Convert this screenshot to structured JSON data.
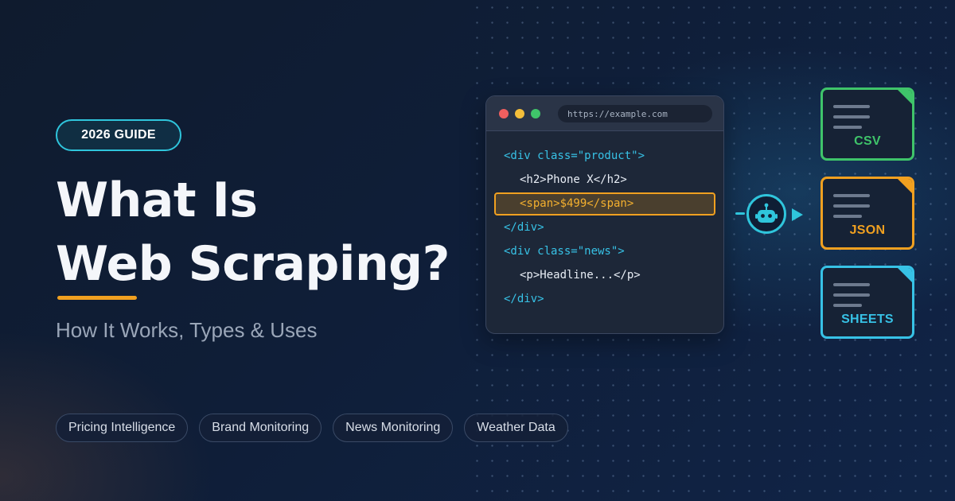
{
  "badge": "2026 GUIDE",
  "title": {
    "line1": "What Is",
    "line2": "Web Scraping?"
  },
  "subtitle": "How It Works, Types & Uses",
  "tags": [
    "Pricing Intelligence",
    "Brand Monitoring",
    "News Monitoring",
    "Weather Data"
  ],
  "browser": {
    "url": "https://example.com",
    "code_lines": [
      "<div class=\"product\">",
      "<h2>Phone X</h2>",
      "<span>$499</span>",
      "</div>",
      "<div class=\"news\">",
      "<p>Headline...</p>",
      "</div>"
    ]
  },
  "outputs": [
    "CSV",
    "JSON",
    "SHEETS"
  ],
  "icons": {
    "window_controls": [
      "close-dot",
      "minimize-dot",
      "maximize-dot"
    ],
    "robot": "robot-icon",
    "arrow": "arrow-right-icon",
    "file": "document-icon"
  },
  "colors": {
    "accent_cyan": "#2fc5dc",
    "accent_orange": "#f0a020",
    "accent_green": "#3fc46a",
    "code_blue": "#37c2e6",
    "background": "#0f1e38"
  }
}
